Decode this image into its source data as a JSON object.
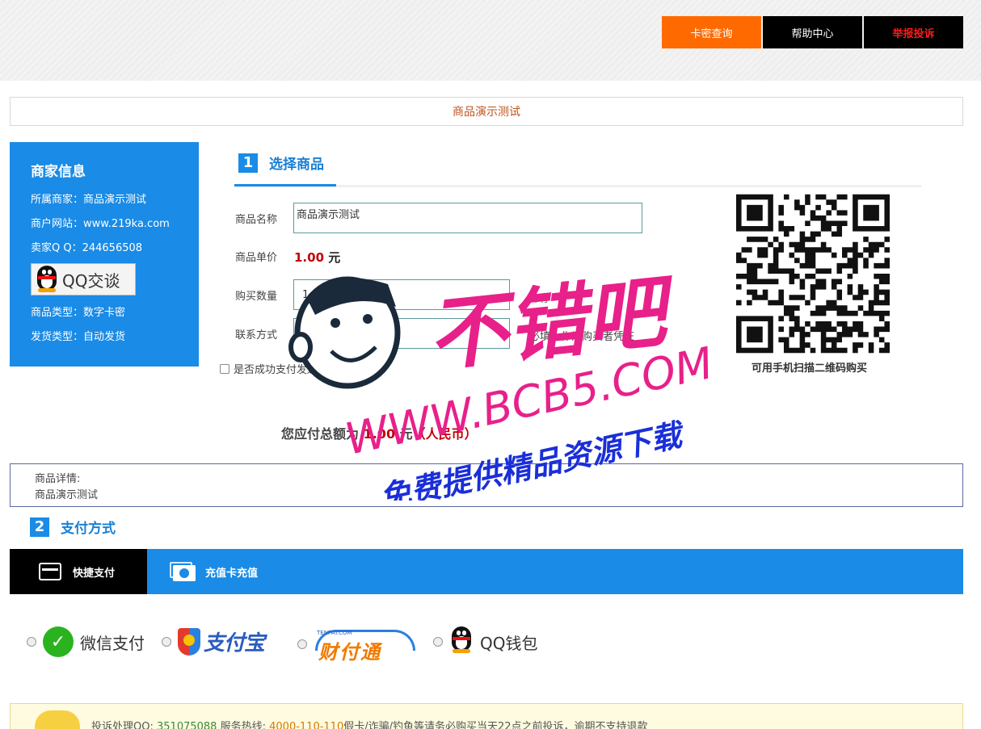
{
  "topnav": {
    "query": "卡密查询",
    "help": "帮助中心",
    "report": "举报投诉"
  },
  "page_title": "商品演示测试",
  "merchant": {
    "heading": "商家信息",
    "merchant_line": "所属商家：商品演示测试",
    "website_line": "商户网站：www.219ka.com",
    "qq_line": "卖家Q Q：244656508",
    "qq_button": "QQ交谈",
    "type_line": "商品类型：数字卡密",
    "ship_line": "发货类型：自动发货"
  },
  "section1": {
    "num": "1",
    "title": "选择商品"
  },
  "form": {
    "name_label": "商品名称",
    "name_value": "商品演示测试",
    "price_label": "商品单价",
    "price_value": "1.00",
    "price_unit": "元",
    "qty_label": "购买数量",
    "qty_value": "1",
    "stock_note": "库存",
    "contact_label": "联系方式",
    "contact_value": "",
    "contact_note": "必填，作为购买者凭证",
    "email_label": "是否成功支付发送到邮箱"
  },
  "qr": {
    "caption": "可用手机扫描二维码购买"
  },
  "total": {
    "prefix": "您应付总额为",
    "amount": "1.00",
    "unit": "元",
    "currency": "（人民币）"
  },
  "details": {
    "label": "商品详情:",
    "text": "商品演示测试"
  },
  "section2": {
    "num": "2",
    "title": "支付方式"
  },
  "pay_tabs": {
    "quick": "快捷支付",
    "card": "充值卡充值"
  },
  "pay_options": {
    "wechat": "微信支付",
    "alipay": "支付宝",
    "tenpay_small": "TENPAY.COM",
    "tenpay": "财付通",
    "qqwallet": "QQ钱包"
  },
  "notice": {
    "qq_prefix": "投诉处理QQ:",
    "qq": "351075088",
    "hotline_prefix": "服务热线:",
    "hotline": "4000-110-110",
    "text": "假卡/诈骗/钓鱼等请务必购买当天22点之前投诉，逾期不支持退款"
  },
  "watermark": {
    "line1": "不错吧",
    "line2": "WWW.BCB5.COM",
    "line3": "免费提供精品资源下载"
  },
  "colors": {
    "accent_blue": "#1a8be6",
    "orange": "#ff6a00",
    "price_red": "#c0000a",
    "watermark_pink": "#e8208a",
    "watermark_blue": "#1a2fd8"
  }
}
